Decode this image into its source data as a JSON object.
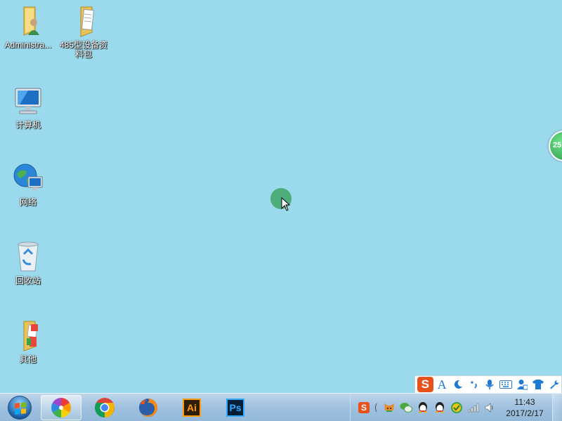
{
  "desktop": {
    "icons": [
      {
        "label": "Administra..."
      },
      {
        "label": "485型设备资料包"
      },
      {
        "label": "计算机"
      },
      {
        "label": "网络"
      },
      {
        "label": "回收站"
      },
      {
        "label": "其他"
      }
    ],
    "float_ball_text": "25"
  },
  "ime_toolbar": {
    "logo": "S",
    "font_label": "A",
    "icons": [
      "moon-icon",
      "punctuation-icon",
      "microphone-icon",
      "keyboard-icon",
      "user-icon",
      "skin-icon",
      "wrench-icon"
    ]
  },
  "taskbar": {
    "apps": [
      {
        "name": "pinwheel-app-icon"
      },
      {
        "name": "chrome-icon"
      },
      {
        "name": "firefox-icon"
      },
      {
        "name": "illustrator-icon",
        "text": "Ai"
      },
      {
        "name": "photoshop-icon",
        "text": "Ps"
      }
    ],
    "clock": {
      "time": "11:43",
      "date": "2017/2/17"
    }
  },
  "colors": {
    "desktop_bg": "#9bd9ec",
    "taskbar": "#9fc1df",
    "ime_logo": "#e8501c"
  }
}
